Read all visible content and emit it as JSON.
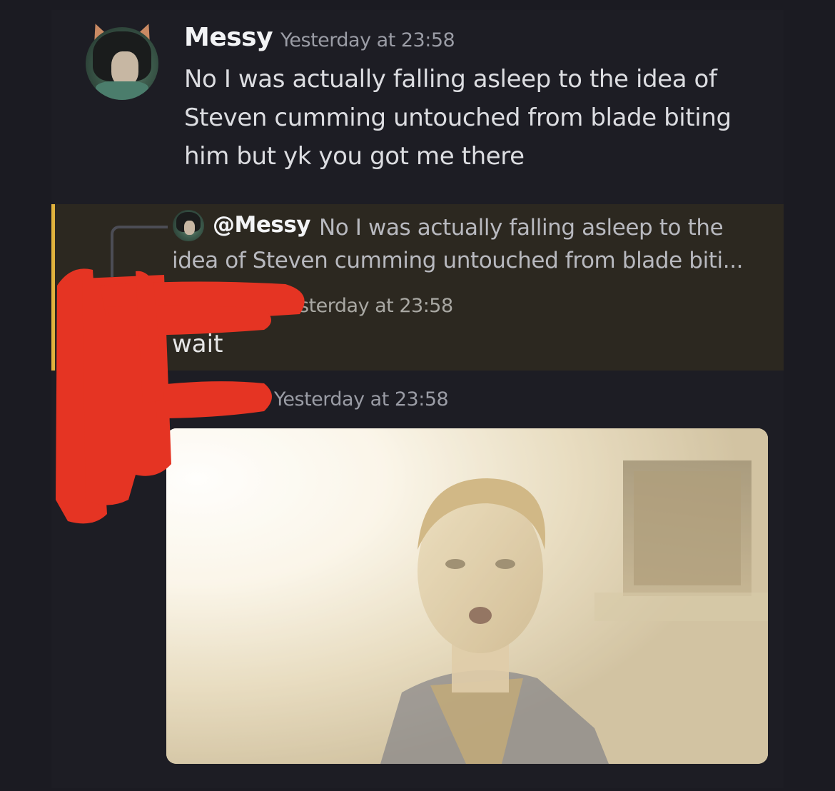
{
  "colors": {
    "background": "#1b1b22",
    "highlight_background": "#2c2820",
    "highlight_bar": "#e0b23d",
    "redaction": "#e53423",
    "text_primary": "#f2f3f5",
    "text_muted": "#9a9ca5"
  },
  "message1": {
    "username": "Messy",
    "timestamp": "Yesterday at 23:58",
    "text": "No I was actually falling asleep to the idea of Steven cumming untouched from blade biting him but yk you got me there",
    "avatar_icon": "cat-ear-avatar"
  },
  "reply_message": {
    "reference": {
      "mention": "@Messy",
      "preview": "No I was actually falling asleep to the idea of Steven cumming untouched from blade biti..."
    },
    "timestamp_partial": "sterday at 23:58",
    "text": "wait"
  },
  "message3": {
    "timestamp": "Yesterday at 23:58",
    "attachment": "gif-image"
  }
}
